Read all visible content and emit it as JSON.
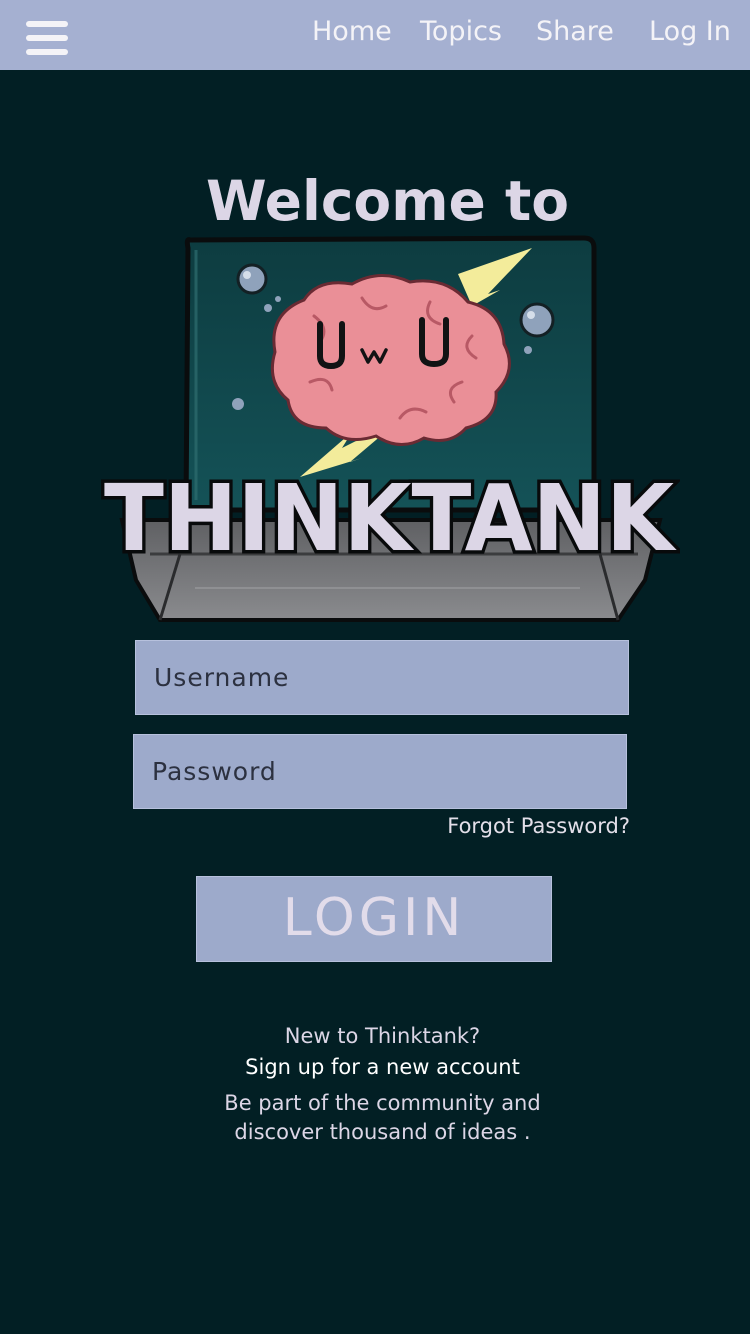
{
  "nav": {
    "menu_icon": "hamburger-menu-icon",
    "items": [
      {
        "label": "Home"
      },
      {
        "label": "Topics"
      },
      {
        "label": "Share"
      },
      {
        "label": "Log In"
      }
    ]
  },
  "hero": {
    "welcome": "Welcome to",
    "logo_text": "THINKTANK",
    "mascot_face": "UwU"
  },
  "form": {
    "username_placeholder": "Username",
    "username_value": "",
    "password_placeholder": "Password",
    "password_value": "",
    "forgot_label": "Forgot Password?",
    "login_label": "LOGIN"
  },
  "footer": {
    "new_to": "New to Thinktank?",
    "signup": "Sign up for a new account",
    "tagline_1": "Be part of the community and",
    "tagline_2": "discover thousand of ideas ."
  },
  "colors": {
    "background": "#021f24",
    "nav_bar": "#a5b0d1",
    "input_fill": "#9daacb",
    "tank_glass": "#0f4346",
    "brain": "#ea8f97",
    "lightning": "#f3ec9b",
    "tank_base": "#6f7073"
  }
}
